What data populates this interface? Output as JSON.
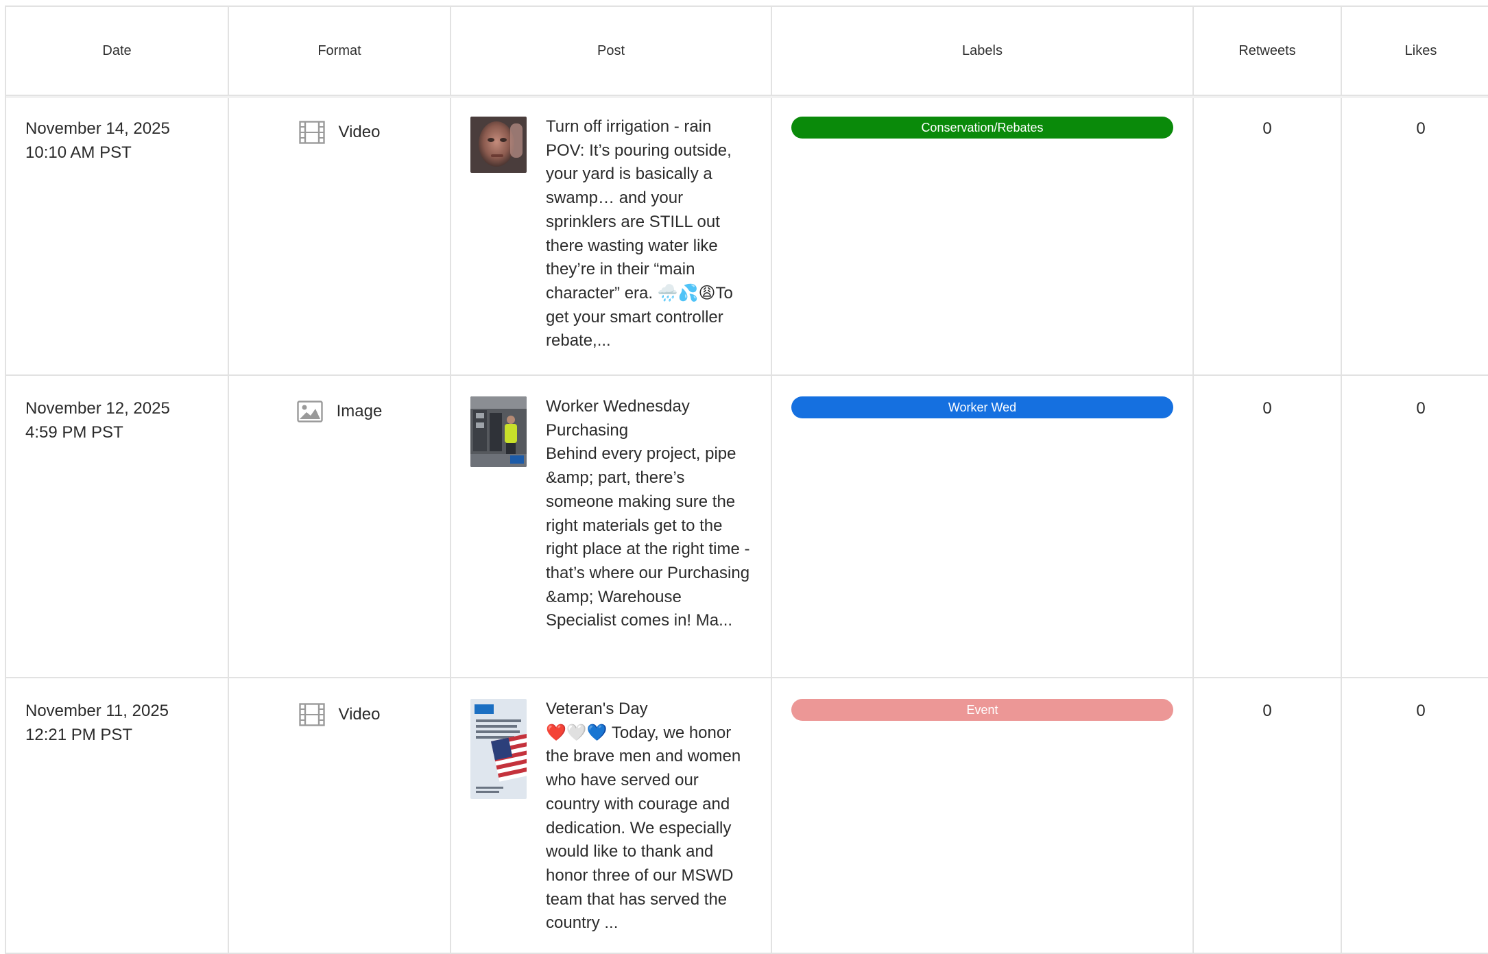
{
  "headers": {
    "date": "Date",
    "format": "Format",
    "post": "Post",
    "labels": "Labels",
    "retweets": "Retweets",
    "likes": "Likes"
  },
  "rows": [
    {
      "date": "November 14, 2025",
      "time": "10:10 AM PST",
      "format": {
        "label": "Video",
        "icon": "film-icon"
      },
      "thumbnail": "man-face-thumbnail",
      "post": "Turn off irrigation - rain\nPOV: It’s pouring outside, your yard is basically a swamp… and your sprinklers are STILL out there wasting water like they’re in their “main character” era. 🌧️💦😩To get your smart controller rebate,...",
      "label": {
        "text": "Conservation/Rebates",
        "color": "#0a8a0a"
      },
      "retweets": "0",
      "likes": "0"
    },
    {
      "date": "November 12, 2025",
      "time": "4:59 PM PST",
      "format": {
        "label": "Image",
        "icon": "image-icon"
      },
      "thumbnail": "warehouse-worker-thumbnail",
      "post": "Worker Wednesday\nPurchasing\nBehind every project, pipe &amp; part, there’s someone making sure the right materials get to the right place at the right time - that’s where our Purchasing &amp; Warehouse Specialist comes in! Ma...",
      "label": {
        "text": "Worker Wed",
        "color": "#1570e0"
      },
      "retweets": "0",
      "likes": "0"
    },
    {
      "date": "November 11, 2025",
      "time": "12:21 PM PST",
      "format": {
        "label": "Video",
        "icon": "film-icon"
      },
      "thumbnail": "flag-poster-thumbnail",
      "post": "Veteran's Day\n❤️🤍💙 Today, we honor the brave men and women who have served our country with courage and dedication. We especially would like to thank and honor three of our MSWD team that has served the country ...",
      "label": {
        "text": "Event",
        "color": "#ec9796"
      },
      "retweets": "0",
      "likes": "0"
    }
  ]
}
